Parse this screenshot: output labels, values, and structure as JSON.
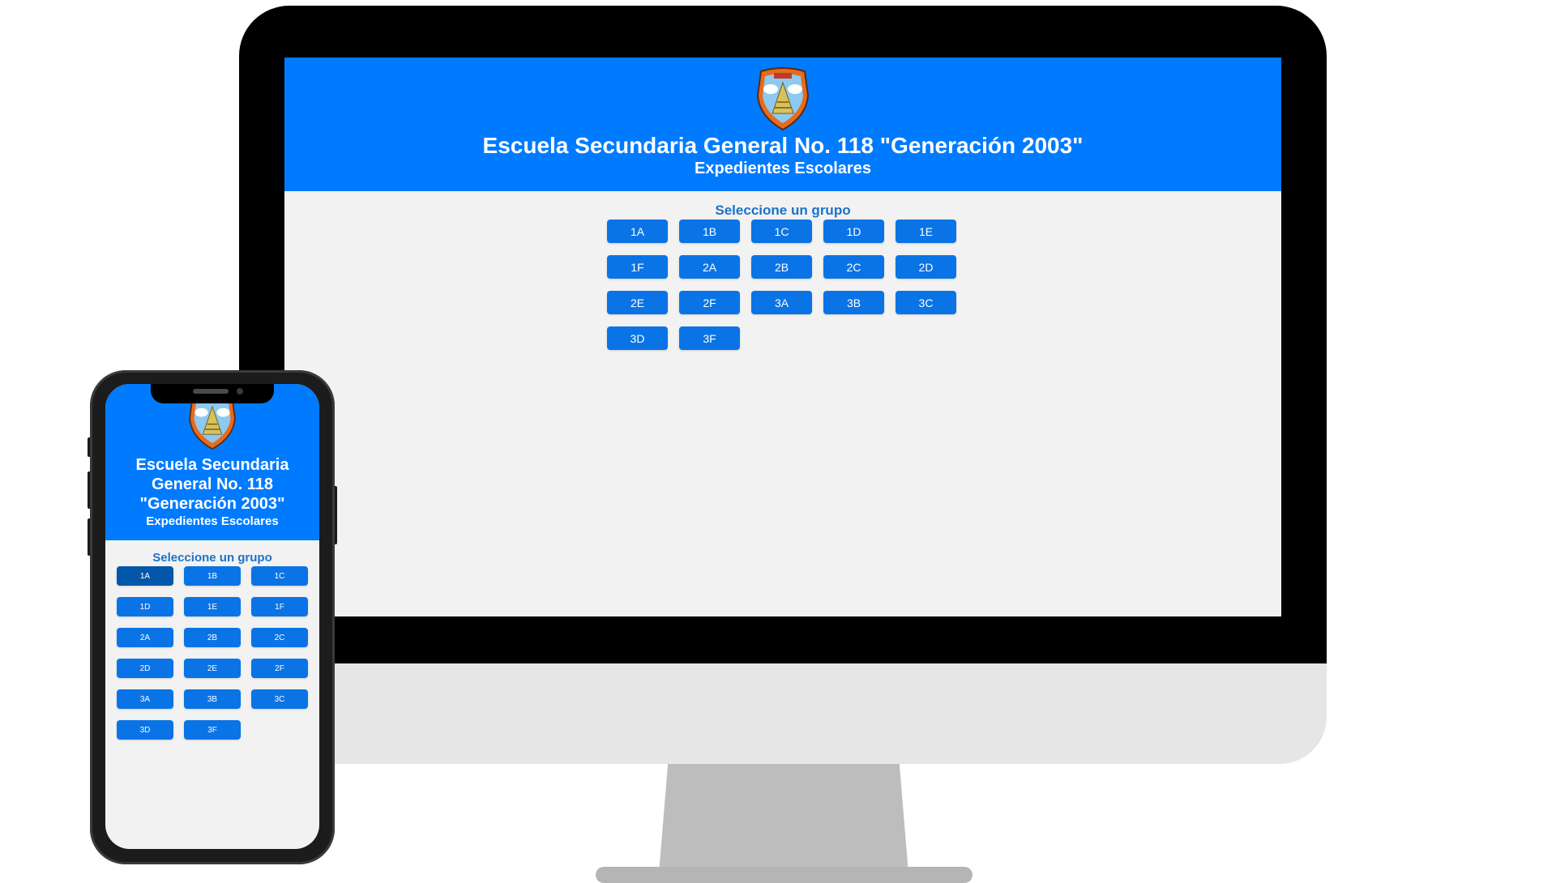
{
  "school": {
    "title": "Escuela Secundaria General No. 118 \"Generación 2003\"",
    "title_mobile_lines": [
      "Escuela Secundaria",
      "General No. 118",
      "\"Generación 2003\""
    ],
    "subtitle": "Expedientes Escolares",
    "select_label": "Seleccione un grupo",
    "logo_icon": "school-crest-icon"
  },
  "colors": {
    "header_blue": "#007bff",
    "button_blue": "#0a74e6",
    "button_active": "#0457a8",
    "label_blue": "#1a73c9",
    "page_bg": "#f2f2f2"
  },
  "desktop": {
    "groups": [
      "1A",
      "1B",
      "1C",
      "1D",
      "1E",
      "1F",
      "2A",
      "2B",
      "2C",
      "2D",
      "2E",
      "2F",
      "3A",
      "3B",
      "3C",
      "3D",
      "3F"
    ]
  },
  "mobile": {
    "active_group": "1A",
    "groups": [
      "1A",
      "1B",
      "1C",
      "1D",
      "1E",
      "1F",
      "2A",
      "2B",
      "2C",
      "2D",
      "2E",
      "2F",
      "3A",
      "3B",
      "3C",
      "3D",
      "3F"
    ]
  }
}
